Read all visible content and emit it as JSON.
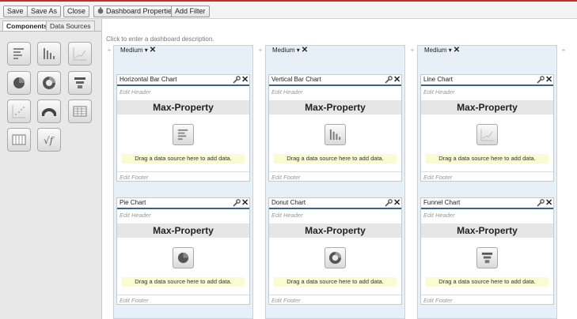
{
  "toolbar": {
    "save": "Save",
    "save_as": "Save As",
    "close": "Close",
    "dashboard_properties": "Dashboard Properties",
    "add_filter": "Add Filter"
  },
  "sidebar": {
    "tabs": [
      "Components",
      "Data Sources"
    ],
    "active_tab": "Components",
    "components": [
      "horizontal-bar",
      "vertical-bar",
      "line",
      "pie",
      "donut",
      "funnel",
      "scatter",
      "gauge",
      "table",
      "table-alt",
      "visualforce"
    ]
  },
  "description_prompt": "Click to enter a dashboard description.",
  "columns": [
    {
      "size": "Medium",
      "panels": [
        {
          "title": "Horizontal Bar Chart",
          "edit_header": "Edit Header",
          "header": "Max-Property",
          "drag_text": "Drag a data source here to add data.",
          "edit_footer": "Edit Footer",
          "icon": "horizontal-bar"
        },
        {
          "title": "Pie Chart",
          "edit_header": "Edit Header",
          "header": "Max-Property",
          "drag_text": "Drag a data source here to add data.",
          "edit_footer": "Edit Footer",
          "icon": "pie"
        }
      ]
    },
    {
      "size": "Medium",
      "panels": [
        {
          "title": "Vertical Bar Chart",
          "edit_header": "Edit Header",
          "header": "Max-Property",
          "drag_text": "Drag a data source here to add data.",
          "edit_footer": "Edit Footer",
          "icon": "vertical-bar"
        },
        {
          "title": "Donut Chart",
          "edit_header": "Edit Header",
          "header": "Max-Property",
          "drag_text": "Drag a data source here to add data.",
          "edit_footer": "Edit Footer",
          "icon": "donut"
        }
      ]
    },
    {
      "size": "Medium",
      "panels": [
        {
          "title": "Line Chart",
          "edit_header": "Edit Header",
          "header": "Max-Property",
          "drag_text": "Drag a data source here to add data.",
          "edit_footer": "Edit Footer",
          "icon": "line"
        },
        {
          "title": "Funnel Chart",
          "edit_header": "Edit Header",
          "header": "Max-Property",
          "drag_text": "Drag a data source here to add data.",
          "edit_footer": "Edit Footer",
          "icon": "funnel"
        }
      ]
    }
  ],
  "colors": {
    "accent_bar": "#b6322a",
    "panel_title_rule": "#3d5f8c",
    "column_bg": "#e7f0f7",
    "drag_bg": "#fbfbd3"
  }
}
